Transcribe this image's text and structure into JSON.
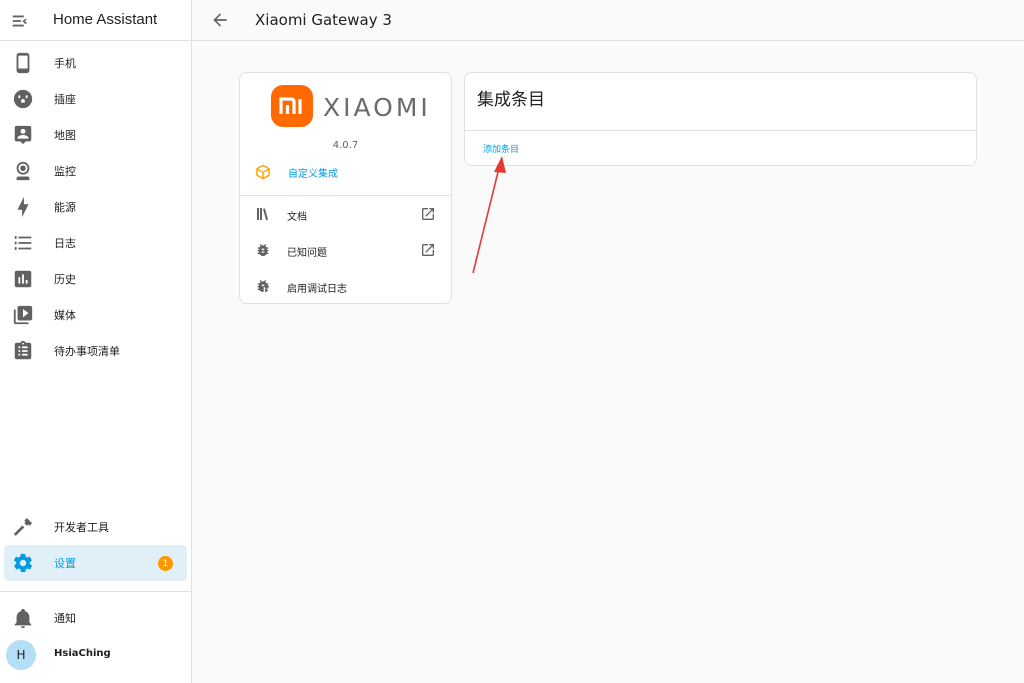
{
  "sidebar": {
    "app_title": "Home Assistant",
    "items": [
      {
        "label": "手机",
        "icon": "phone-icon"
      },
      {
        "label": "插座",
        "icon": "outlet-icon"
      },
      {
        "label": "地图",
        "icon": "map-account-icon"
      },
      {
        "label": "监控",
        "icon": "webcam-icon"
      },
      {
        "label": "能源",
        "icon": "lightning-bolt-icon"
      },
      {
        "label": "日志",
        "icon": "format-list-bulleted-icon"
      },
      {
        "label": "历史",
        "icon": "chart-box-icon"
      },
      {
        "label": "媒体",
        "icon": "play-box-multiple-icon"
      },
      {
        "label": "待办事项清单",
        "icon": "clipboard-list-icon"
      }
    ],
    "developer_tools": {
      "label": "开发者工具",
      "icon": "hammer-icon"
    },
    "settings": {
      "label": "设置",
      "icon": "cog-icon",
      "badge": "1"
    },
    "notifications": {
      "label": "通知",
      "icon": "bell-icon"
    },
    "user": {
      "avatar_initial": "H",
      "name": "HsiaChing"
    }
  },
  "header": {
    "title": "Xiaomi Gateway 3"
  },
  "info_card": {
    "brand_wordmark": "XIAOMI",
    "logo_mark": "mi",
    "version": "4.0.7",
    "custom_label": "自定义集成",
    "links": [
      {
        "label": "文档",
        "icon": "bookshelf-icon",
        "external": true
      },
      {
        "label": "已知问题",
        "icon": "bug-icon",
        "external": true
      },
      {
        "label": "启用调试日志",
        "icon": "bug-play-icon",
        "external": false
      }
    ]
  },
  "entries_card": {
    "title": "集成条目",
    "add_entry_label": "添加条目"
  },
  "colors": {
    "accent": "#039be5",
    "active_bg": "#e1f0f8",
    "badge": "#ff9800",
    "brand": "#ff6900",
    "custom_icon": "#ffa600",
    "annotation_arrow": "#e53935"
  }
}
